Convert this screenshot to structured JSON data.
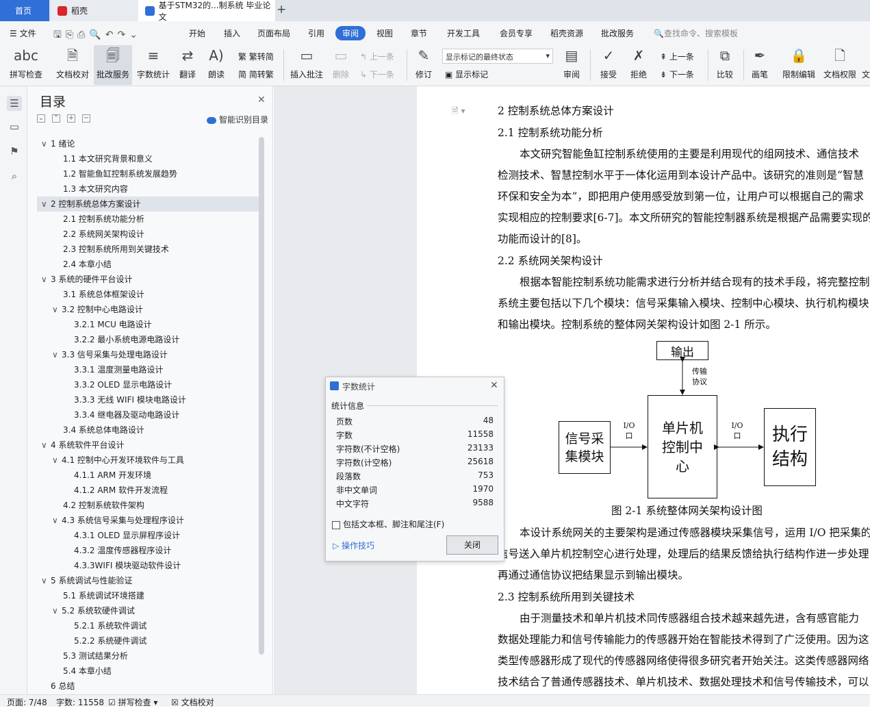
{
  "tabs": {
    "home": "首页",
    "daoke": "稻壳",
    "doc": "基于STM32的...制系统 毕业论文",
    "new_tab": "+"
  },
  "menubar": {
    "file": "文件",
    "items": [
      "开始",
      "插入",
      "页面布局",
      "引用",
      "审阅",
      "视图",
      "章节",
      "开发工具",
      "会员专享",
      "稻壳资源",
      "批改服务"
    ],
    "active": "审阅",
    "search": "查找命令、搜索模板"
  },
  "ribbon": {
    "spell": "拼写检查",
    "proofread": "文档校对",
    "revise_service": "批改服务",
    "word_count": "字数统计",
    "translate": "翻译",
    "read_aloud": "朗读",
    "to_trad": "繁转简",
    "to_simp": "简转繁",
    "insert_comment": "插入批注",
    "delete": "删除",
    "prev1": "上一条",
    "next1": "下一条",
    "track": "修订",
    "markup_state": "显示标记的最终状态",
    "show_markup": "显示标记",
    "review": "审阅",
    "accept": "接受",
    "reject": "拒绝",
    "prev2": "上一条",
    "next2": "下一条",
    "compare": "比较",
    "pen": "画笔",
    "restrict": "限制编辑",
    "doc_perm": "文档权限",
    "more": "文"
  },
  "toc": {
    "title": "目录",
    "smart": "智能识别目录",
    "items": [
      {
        "text": "1  绪论",
        "level": 0,
        "caret": "∨"
      },
      {
        "text": "1.1 本文研究背景和意义",
        "level": 1
      },
      {
        "text": "1.2 智能鱼缸控制系统发展趋势",
        "level": 1
      },
      {
        "text": "1.3 本文研究内容",
        "level": 1
      },
      {
        "text": "2  控制系统总体方案设计",
        "level": 0,
        "caret": "∨",
        "active": true
      },
      {
        "text": "2.1 控制系统功能分析",
        "level": 1
      },
      {
        "text": "2.2 系统网关架构设计",
        "level": 1
      },
      {
        "text": "2.3 控制系统所用到关键技术",
        "level": 1
      },
      {
        "text": "2.4 本章小结",
        "level": 1
      },
      {
        "text": "3  系统的硬件平台设计",
        "level": 0,
        "caret": "∨"
      },
      {
        "text": "3.1 系统总体框架设计",
        "level": 1
      },
      {
        "text": "3.2 控制中心电路设计",
        "level": 1,
        "caret": "∨"
      },
      {
        "text": "3.2.1 MCU 电路设计",
        "level": 2
      },
      {
        "text": "3.2.2 最小系统电源电路设计",
        "level": 2
      },
      {
        "text": "3.3 信号采集与处理电路设计",
        "level": 1,
        "caret": "∨"
      },
      {
        "text": "3.3.1 温度测量电路设计",
        "level": 2
      },
      {
        "text": "3.3.2 OLED 显示电路设计",
        "level": 2
      },
      {
        "text": "3.3.3 无线 WIFI 模块电路设计",
        "level": 2
      },
      {
        "text": "3.3.4 继电器及驱动电路设计",
        "level": 2
      },
      {
        "text": "3.4 系统总体电路设计",
        "level": 1
      },
      {
        "text": "4  系统软件平台设计",
        "level": 0,
        "caret": "∨"
      },
      {
        "text": "4.1 控制中心开发环境软件与工具",
        "level": 1,
        "caret": "∨"
      },
      {
        "text": "4.1.1 ARM 开发环境",
        "level": 2
      },
      {
        "text": "4.1.2 ARM 软件开发流程",
        "level": 2
      },
      {
        "text": "4.2 控制系统软件架构",
        "level": 1
      },
      {
        "text": "4.3 系统信号采集与处理程序设计",
        "level": 1,
        "caret": "∨"
      },
      {
        "text": "4.3.1 OLED 显示屏程序设计",
        "level": 2
      },
      {
        "text": "4.3.2 温度传感器程序设计",
        "level": 2
      },
      {
        "text": "4.3.3WIFI 模块驱动软件设计",
        "level": 2
      },
      {
        "text": "5  系统调试与性能验证",
        "level": 0,
        "caret": "∨"
      },
      {
        "text": "5.1 系统调试环境搭建",
        "level": 1
      },
      {
        "text": "5.2 系统软硬件调试",
        "level": 1,
        "caret": "∨"
      },
      {
        "text": "5.2.1 系统软件调试",
        "level": 2
      },
      {
        "text": "5.2.2 系统硬件调试",
        "level": 2
      },
      {
        "text": "5.3 测试结果分析",
        "level": 1
      },
      {
        "text": "5.4 本章小结",
        "level": 1
      },
      {
        "text": "6  总结",
        "level": 0
      }
    ]
  },
  "doc": {
    "lines": [
      "2  控制系统总体方案设计",
      "2.1 控制系统功能分析",
      "本文研究智能鱼缸控制系统使用的主要是利用现代的组网技术、通信技术",
      "检测技术、智慧控制水平于一体化运用到本设计产品中。该研究的准则是“智慧",
      "环保和安全为本”，即把用户使用感受放到第一位，让用户可以根据自己的需求",
      "实现相应的控制要求[6-7]。本文所研究的智能控制器系统是根据产品需要实现的",
      "功能而设计的[8]。",
      "2.2 系统网关架构设计",
      "根据本智能控制系统功能需求进行分析并结合现有的技术手段，将完整控制",
      "系统主要包括以下几个模块：信号采集输入模块、控制中心模块、执行机构模块",
      "和输出模块。控制系统的整体网关架构设计如图 2-1 所示。",
      "图 2-1 系统整体网关架构设计图",
      "本设计系统网关的主要架构是通过传感器模块采集信号，运用 I/O 把采集的",
      "信号送入单片机控制空心进行处理，处理后的结果反馈给执行结构作进一步处理",
      "再通过通信协议把结果显示到输出模块。",
      "2.3 控制系统所用到关键技术",
      "由于测量技术和单片机技术同传感器组合技术越来越先进，含有感官能力",
      "数据处理能力和信号传输能力的传感器开始在智能技术得到了广泛使用。因为这",
      "类型传感器形成了现代的传感器网络使得很多研究者开始关注。这类传感器网络",
      "技术结合了普通传感器技术、单片机技术、数据处理技术和信号传输技术，可以"
    ]
  },
  "figure": {
    "output": "输出",
    "protocol": "传输\n协议",
    "mcu": "单片机\n控制中\n心",
    "sensor": "信号采\n集模块",
    "io_left": "I/O\n口",
    "io_right": "I/O\n口",
    "actuator": "执行\n结构"
  },
  "dialog": {
    "title": "字数统计",
    "section": "统计信息",
    "rows": [
      {
        "label": "页数",
        "value": "48"
      },
      {
        "label": "字数",
        "value": "11558"
      },
      {
        "label": "字符数(不计空格)",
        "value": "23133"
      },
      {
        "label": "字符数(计空格)",
        "value": "25618"
      },
      {
        "label": "段落数",
        "value": "753"
      },
      {
        "label": "非中文单词",
        "value": "1970"
      },
      {
        "label": "中文字符",
        "value": "9588"
      }
    ],
    "checkbox": "包括文本框、脚注和尾注(F)",
    "tips": "操作技巧",
    "close": "关闭"
  },
  "status": {
    "page": "页面: 7/48",
    "words": "字数: 11558",
    "spell": "拼写检查",
    "proof": "文档校对"
  },
  "colors": {
    "accent": "#2f6fd6"
  }
}
